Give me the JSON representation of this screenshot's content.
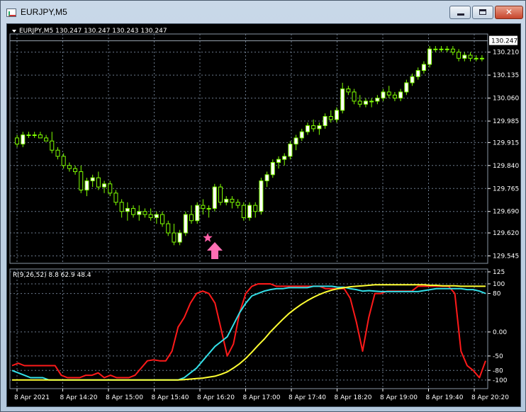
{
  "window": {
    "title": "EURJPY,M5",
    "controls": {
      "minimize": "–",
      "maximize": "□",
      "close": "✕"
    }
  },
  "chart_data": [
    {
      "type": "candlestick",
      "symbol_header": "EURJPY,M5",
      "ohlc_header": "130.247 130.247 130.243 130.247",
      "current_price": "130.247",
      "y_ticks": [
        "130.210",
        "130.135",
        "130.060",
        "129.985",
        "129.915",
        "129.840",
        "129.765",
        "129.690",
        "129.620",
        "129.545"
      ],
      "ylim": [
        129.545,
        130.247
      ],
      "grid": true,
      "colors": {
        "background": "#000000",
        "bull_body": "#ffffff",
        "bear_body": "#000000",
        "wick": "#7fff00",
        "grid": "#6b7a8c"
      },
      "candles": [
        [
          129.93,
          129.94,
          129.9,
          129.91
        ],
        [
          129.91,
          129.95,
          129.9,
          129.94
        ],
        [
          129.94,
          129.95,
          129.93,
          129.94
        ],
        [
          129.94,
          129.95,
          129.93,
          129.94
        ],
        [
          129.94,
          129.95,
          129.93,
          129.93
        ],
        [
          129.93,
          129.94,
          129.92,
          129.92
        ],
        [
          129.92,
          129.95,
          129.88,
          129.89
        ],
        [
          129.89,
          129.9,
          129.86,
          129.87
        ],
        [
          129.87,
          129.88,
          129.83,
          129.84
        ],
        [
          129.84,
          129.85,
          129.82,
          129.83
        ],
        [
          129.83,
          129.84,
          129.81,
          129.82
        ],
        [
          129.82,
          129.84,
          129.75,
          129.76
        ],
        [
          129.76,
          129.8,
          129.74,
          129.79
        ],
        [
          129.79,
          129.81,
          129.77,
          129.8
        ],
        [
          129.8,
          129.82,
          129.76,
          129.77
        ],
        [
          129.77,
          129.79,
          129.75,
          129.78
        ],
        [
          129.78,
          129.79,
          129.74,
          129.75
        ],
        [
          129.75,
          129.76,
          129.71,
          129.72
        ],
        [
          129.72,
          129.73,
          129.67,
          129.69
        ],
        [
          129.69,
          129.72,
          129.66,
          129.7
        ],
        [
          129.7,
          129.71,
          129.67,
          129.68
        ],
        [
          129.68,
          129.71,
          129.66,
          129.69
        ],
        [
          129.69,
          129.7,
          129.67,
          129.68
        ],
        [
          129.68,
          129.7,
          129.66,
          129.67
        ],
        [
          129.67,
          129.69,
          129.65,
          129.68
        ],
        [
          129.68,
          129.69,
          129.64,
          129.65
        ],
        [
          129.65,
          129.66,
          129.61,
          129.62
        ],
        [
          129.62,
          129.65,
          129.58,
          129.59
        ],
        [
          129.59,
          129.63,
          129.58,
          129.62
        ],
        [
          129.62,
          129.69,
          129.61,
          129.68
        ],
        [
          129.68,
          129.71,
          129.65,
          129.66
        ],
        [
          129.66,
          129.72,
          129.65,
          129.71
        ],
        [
          129.71,
          129.73,
          129.68,
          129.7
        ],
        [
          129.7,
          129.71,
          129.67,
          129.7
        ],
        [
          129.7,
          129.78,
          129.69,
          129.77
        ],
        [
          129.77,
          129.78,
          129.71,
          129.72
        ],
        [
          129.72,
          129.74,
          129.71,
          129.73
        ],
        [
          129.73,
          129.74,
          129.7,
          129.72
        ],
        [
          129.72,
          129.73,
          129.7,
          129.71
        ],
        [
          129.71,
          129.72,
          129.66,
          129.67
        ],
        [
          129.67,
          129.72,
          129.66,
          129.71
        ],
        [
          129.71,
          129.72,
          129.67,
          129.69
        ],
        [
          129.69,
          129.8,
          129.68,
          129.79
        ],
        [
          129.79,
          129.82,
          129.77,
          129.81
        ],
        [
          129.81,
          129.86,
          129.8,
          129.85
        ],
        [
          129.85,
          129.87,
          129.83,
          129.86
        ],
        [
          129.86,
          129.88,
          129.84,
          129.87
        ],
        [
          129.87,
          129.92,
          129.86,
          129.91
        ],
        [
          129.91,
          129.94,
          129.89,
          129.93
        ],
        [
          129.93,
          129.96,
          129.92,
          129.95
        ],
        [
          129.95,
          129.98,
          129.94,
          129.97
        ],
        [
          129.97,
          129.99,
          129.95,
          129.96
        ],
        [
          129.96,
          129.98,
          129.94,
          129.97
        ],
        [
          129.97,
          130.01,
          129.96,
          130.0
        ],
        [
          130.0,
          130.02,
          129.98,
          129.99
        ],
        [
          129.99,
          130.03,
          129.98,
          130.02
        ],
        [
          130.02,
          130.11,
          130.01,
          130.09
        ],
        [
          130.09,
          130.1,
          130.07,
          130.08
        ],
        [
          130.08,
          130.09,
          130.04,
          130.05
        ],
        [
          130.05,
          130.07,
          130.03,
          130.04
        ],
        [
          130.04,
          130.06,
          130.03,
          130.05
        ],
        [
          130.05,
          130.06,
          130.03,
          130.05
        ],
        [
          130.05,
          130.07,
          130.04,
          130.06
        ],
        [
          130.06,
          130.09,
          130.05,
          130.08
        ],
        [
          130.08,
          130.1,
          130.06,
          130.07
        ],
        [
          130.07,
          130.08,
          130.05,
          130.06
        ],
        [
          130.06,
          130.09,
          130.05,
          130.08
        ],
        [
          130.08,
          130.12,
          130.07,
          130.11
        ],
        [
          130.11,
          130.14,
          130.1,
          130.13
        ],
        [
          130.13,
          130.16,
          130.12,
          130.15
        ],
        [
          130.15,
          130.18,
          130.14,
          130.17
        ],
        [
          130.17,
          130.23,
          130.16,
          130.22
        ],
        [
          130.22,
          130.23,
          130.21,
          130.22
        ],
        [
          130.22,
          130.23,
          130.21,
          130.22
        ],
        [
          130.22,
          130.23,
          130.21,
          130.22
        ],
        [
          130.22,
          130.23,
          130.2,
          130.21
        ],
        [
          130.21,
          130.22,
          130.18,
          130.19
        ],
        [
          130.19,
          130.21,
          130.18,
          130.2
        ],
        [
          130.2,
          130.21,
          130.18,
          130.19
        ],
        [
          130.19,
          130.2,
          130.18,
          130.19
        ],
        [
          130.19,
          130.2,
          130.18,
          130.19
        ]
      ],
      "annotations": [
        "pink star",
        "pink up arrow"
      ]
    },
    {
      "type": "line",
      "header": "R(9,26,52) 8.8 62.9 48.4",
      "y_ticks": [
        "125",
        "100",
        "80",
        "0.00",
        "-50",
        "-80",
        "-100"
      ],
      "ylim": [
        -112,
        125
      ],
      "grid": true,
      "series": [
        {
          "color": "#ff1a1a",
          "values": [
            -70,
            -65,
            -70,
            -70,
            -70,
            -70,
            -70,
            -70,
            -90,
            -95,
            -95,
            -95,
            -90,
            -90,
            -85,
            -95,
            -90,
            -95,
            -95,
            -95,
            -90,
            -75,
            -60,
            -58,
            -60,
            -60,
            -40,
            10,
            30,
            60,
            80,
            85,
            80,
            60,
            5,
            -50,
            -25,
            40,
            80,
            95,
            100,
            100,
            100,
            95,
            95,
            95,
            95,
            95,
            95,
            95,
            95,
            90,
            90,
            90,
            90,
            70,
            20,
            -40,
            30,
            80,
            80,
            85,
            85,
            85,
            85,
            85,
            95,
            95,
            95,
            95,
            95,
            95,
            80,
            -40,
            -70,
            -80,
            -95,
            -60
          ]
        },
        {
          "color": "#33e0e8",
          "values": [
            -80,
            -85,
            -90,
            -95,
            -95,
            -95,
            -100,
            -100,
            -100,
            -100,
            -100,
            -100,
            -100,
            -100,
            -100,
            -100,
            -100,
            -100,
            -100,
            -100,
            -100,
            -100,
            -100,
            -100,
            -100,
            -100,
            -100,
            -100,
            -95,
            -85,
            -75,
            -60,
            -45,
            -30,
            -20,
            -10,
            15,
            40,
            60,
            75,
            80,
            85,
            88,
            90,
            90,
            92,
            92,
            92,
            92,
            95,
            95,
            95,
            95,
            93,
            93,
            90,
            88,
            85,
            86,
            85,
            84,
            84,
            84,
            84,
            84,
            84,
            84,
            86,
            88,
            90,
            90,
            90,
            90,
            90,
            88,
            88,
            85,
            80
          ]
        },
        {
          "color": "#ffff33",
          "values": [
            -100,
            -100,
            -100,
            -100,
            -100,
            -100,
            -100,
            -100,
            -100,
            -100,
            -100,
            -100,
            -100,
            -100,
            -100,
            -100,
            -100,
            -100,
            -100,
            -100,
            -100,
            -100,
            -100,
            -100,
            -100,
            -100,
            -100,
            -100,
            -99,
            -98,
            -97,
            -96,
            -94,
            -92,
            -88,
            -83,
            -75,
            -66,
            -55,
            -42,
            -28,
            -15,
            0,
            13,
            26,
            38,
            48,
            57,
            65,
            72,
            78,
            83,
            87,
            90,
            92,
            94,
            95,
            96,
            97,
            98,
            98,
            98,
            98,
            98,
            98,
            98,
            98,
            98,
            97,
            97,
            96,
            96,
            96,
            95,
            95,
            95,
            95,
            95
          ]
        }
      ]
    }
  ],
  "x_labels": [
    "8 Apr 2021",
    "8 Apr 14:20",
    "8 Apr 15:00",
    "8 Apr 15:40",
    "8 Apr 16:20",
    "8 Apr 17:00",
    "8 Apr 17:40",
    "8 Apr 18:20",
    "8 Apr 19:00",
    "8 Apr 19:40",
    "8 Apr 20:20"
  ]
}
